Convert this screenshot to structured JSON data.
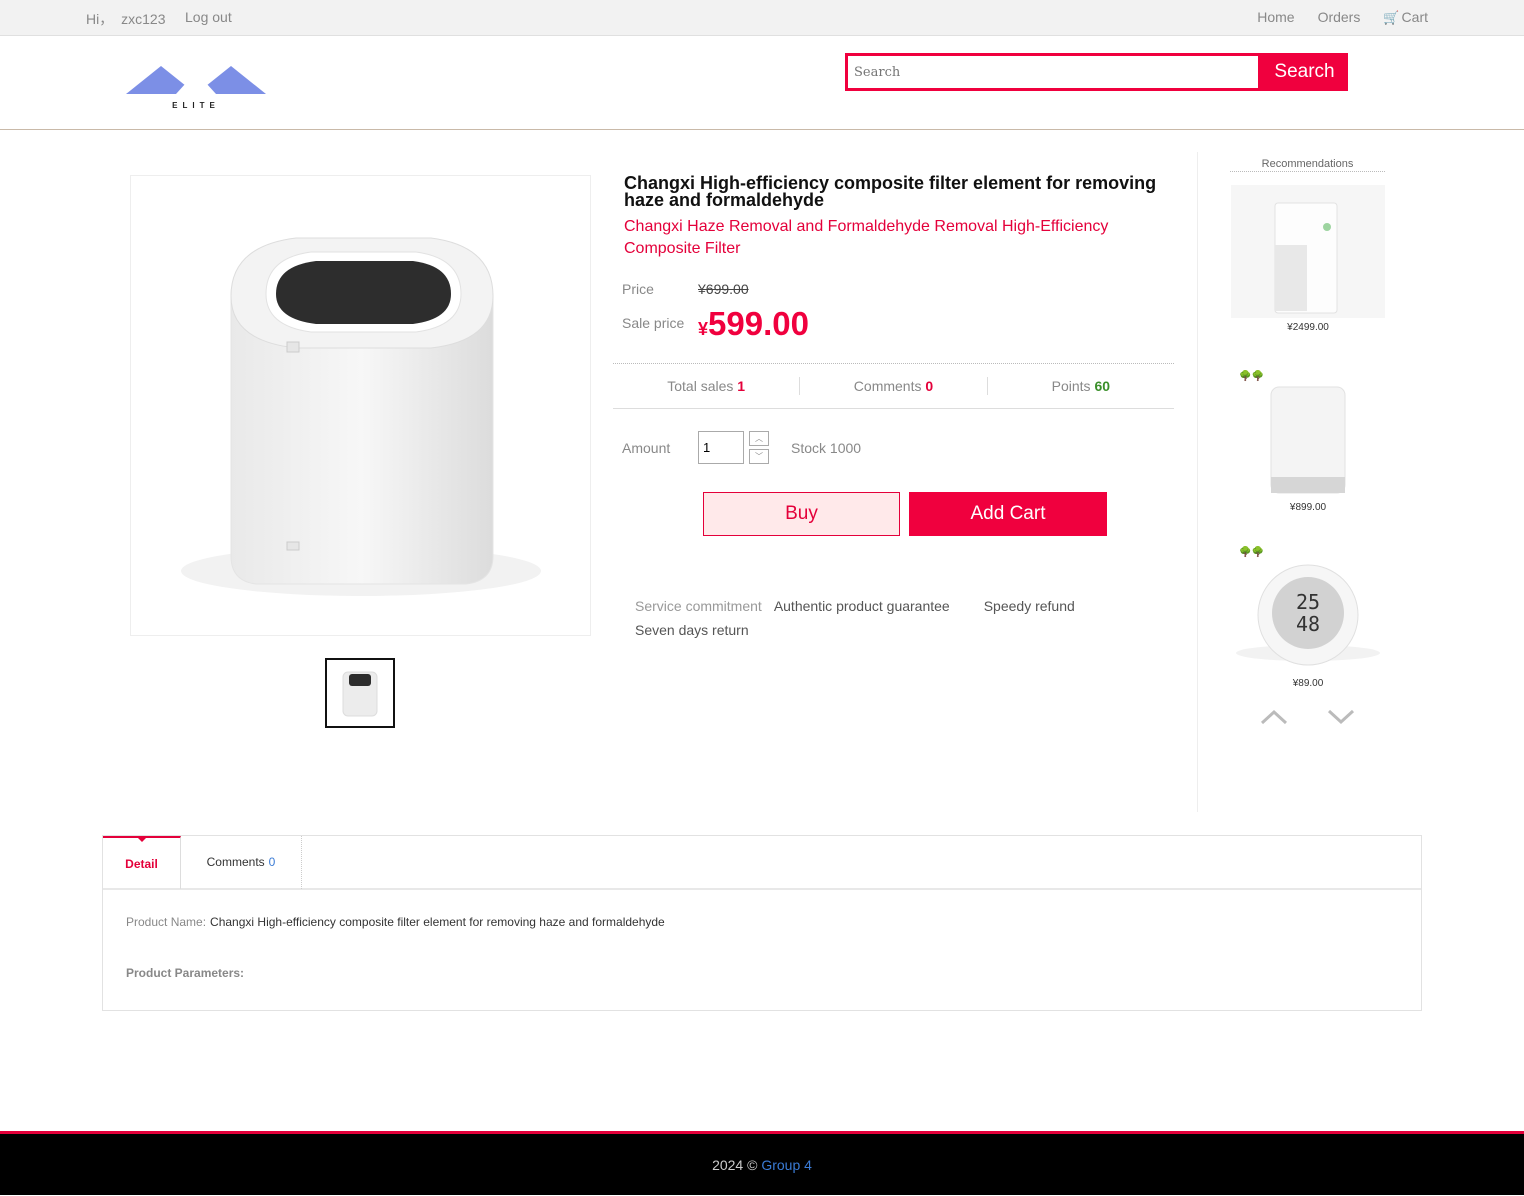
{
  "topbar": {
    "greeting": "Hi，",
    "username": "zxc123",
    "logout": "Log out",
    "nav": {
      "home": "Home",
      "orders": "Orders",
      "cart": "Cart"
    }
  },
  "header": {
    "logo_text": "ELITE",
    "search_placeholder": "Search",
    "search_button": "Search"
  },
  "product": {
    "title": "Changxi High-efficiency composite filter element for removing haze and formaldehyde",
    "subtitle": "Changxi Haze Removal and Formaldehyde Removal High-Efficiency Composite Filter",
    "price_label": "Price",
    "original_price": "¥699.00",
    "sale_price_label": "Sale price",
    "sale_currency": "¥",
    "sale_price": "599.00",
    "stats": {
      "sales_label": "Total sales",
      "sales_value": "1",
      "comments_label": "Comments",
      "comments_value": "0",
      "points_label": "Points",
      "points_value": "60"
    },
    "amount_label": "Amount",
    "amount_value": "1",
    "stock": "Stock 1000",
    "buy_button": "Buy",
    "add_cart_button": "Add Cart",
    "service": {
      "label": "Service commitment",
      "items": [
        "Authentic product guarantee",
        "Speedy refund",
        "Seven days return"
      ]
    }
  },
  "recommendations": {
    "title": "Recommendations",
    "items": [
      {
        "price": "¥2499.00"
      },
      {
        "price": "¥899.00"
      },
      {
        "price": "¥89.00"
      }
    ]
  },
  "tabs": {
    "detail": "Detail",
    "comments": "Comments",
    "comments_count": "0",
    "product_name_label": "Product Name:",
    "product_name": "Changxi High-efficiency composite filter element for removing haze and formaldehyde",
    "params_label": "Product Parameters:"
  },
  "footer": {
    "copyright": "2024 ©",
    "group": "Group 4"
  },
  "colors": {
    "accent": "#f0003e",
    "green": "#3a8f2a",
    "link": "#3a7bd5"
  }
}
